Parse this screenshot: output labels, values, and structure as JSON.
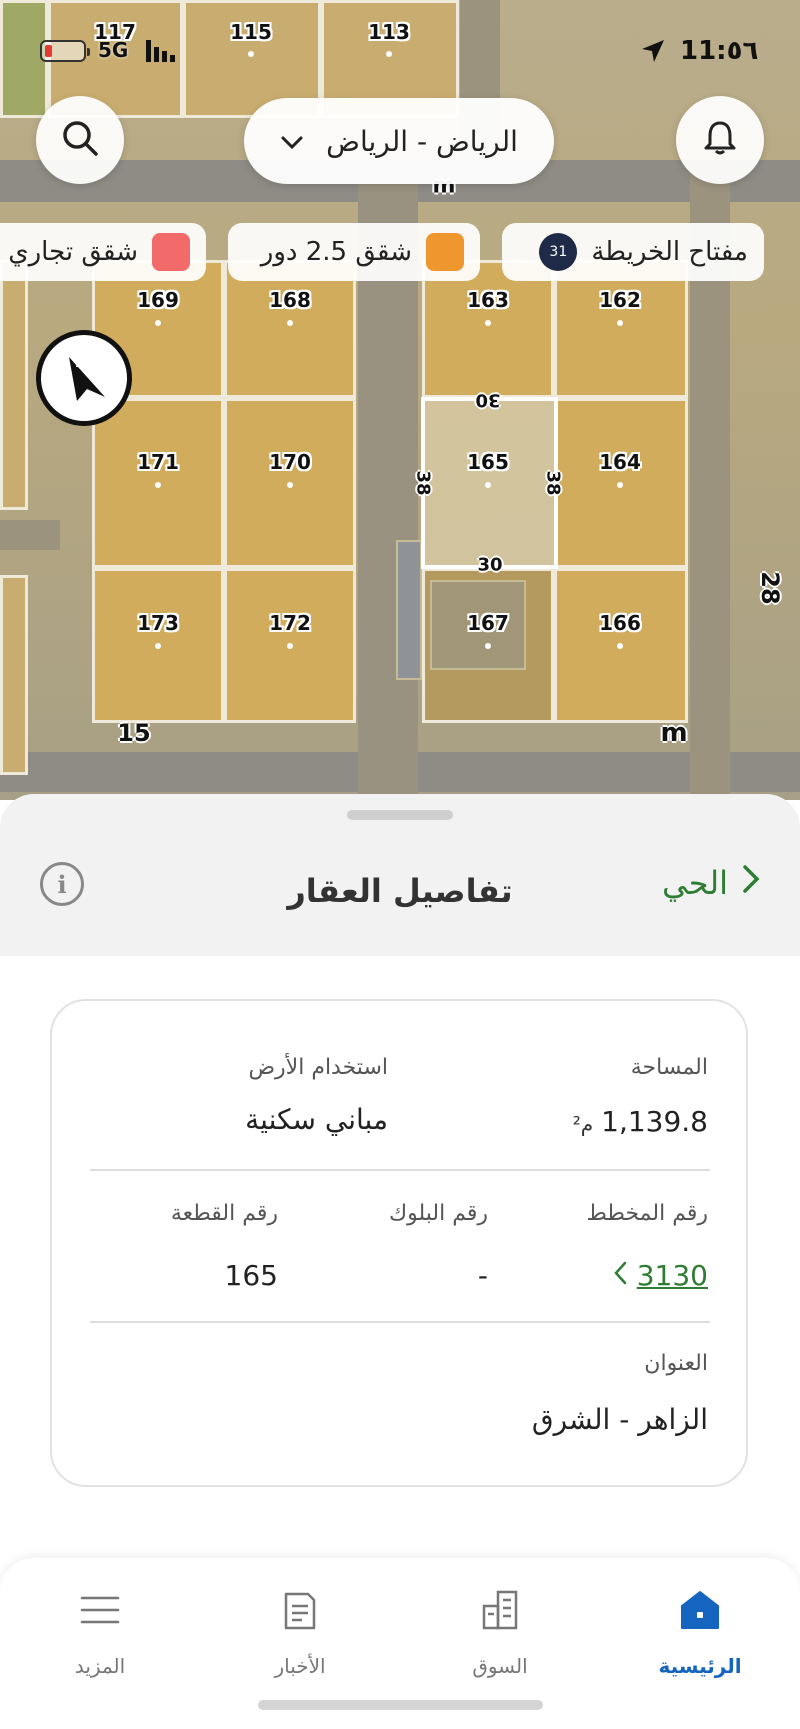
{
  "status_bar": {
    "time": "11:٥٦",
    "network": "5G",
    "location_icon": "location-arrow-icon",
    "battery_color": "#e53935"
  },
  "map": {
    "search_icon": "search-icon",
    "notification_icon": "bell-icon",
    "city_selector": "الرياض - الرياض",
    "legend_chips": [
      {
        "label": "مفتاح الخريطة",
        "badge": "31",
        "badge_color": "#1e2a47"
      },
      {
        "label": "شقق 2.5 دور",
        "color": "#f0962e"
      },
      {
        "label": "شقق تجاري",
        "color": "#f26a6a"
      }
    ],
    "compass_label": "N",
    "plots": [
      {
        "label": "117",
        "row": "top",
        "pos": 0
      },
      {
        "label": "115",
        "row": "top",
        "pos": 1
      },
      {
        "label": "113",
        "row": "top",
        "pos": 2
      },
      {
        "label": "169"
      },
      {
        "label": "168"
      },
      {
        "label": "163"
      },
      {
        "label": "162"
      },
      {
        "label": "171"
      },
      {
        "label": "170"
      },
      {
        "label": "165"
      },
      {
        "label": "164"
      },
      {
        "label": "173"
      },
      {
        "label": "172"
      },
      {
        "label": "167"
      },
      {
        "label": "166"
      }
    ],
    "selected_plot_dims": {
      "top": "30",
      "bottom": "30",
      "left": "38",
      "right": "38"
    },
    "road_labels": {
      "bottom_left": "15",
      "bottom_right": "m",
      "top": "m",
      "right": "28"
    }
  },
  "sheet": {
    "title": "تفاصيل العقار",
    "back_link": "الحي",
    "info_icon": "info-icon",
    "fields": {
      "area_label": "المساحة",
      "area_value": "1,139.8",
      "area_unit": "م²",
      "land_use_label": "استخدام الأرض",
      "land_use_value": "مباني سكنية",
      "plan_label": "رقم المخطط",
      "plan_value": "3130",
      "block_label": "رقم البلوك",
      "block_value": "-",
      "plot_label": "رقم القطعة",
      "plot_value": "165",
      "address_label": "العنوان",
      "address_value": "الزاهر - الشرق"
    }
  },
  "bottom_nav": {
    "items": [
      {
        "label": "الرئيسية",
        "icon": "home-icon",
        "active": true
      },
      {
        "label": "السوق",
        "icon": "buildings-icon",
        "active": false
      },
      {
        "label": "الأخبار",
        "icon": "news-icon",
        "active": false
      },
      {
        "label": "المزيد",
        "icon": "menu-icon",
        "active": false
      }
    ]
  },
  "colors": {
    "accent_green": "#2e7d32",
    "nav_active_blue": "#1565c0"
  }
}
